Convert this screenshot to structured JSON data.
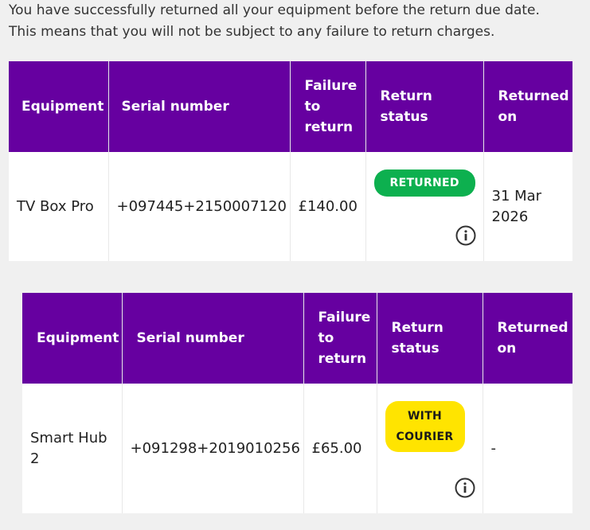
{
  "intro": {
    "line1": "You have successfully returned all your equipment before the return due date.",
    "line2": "This means that you will not be subject to any failure to return charges."
  },
  "tables": [
    {
      "headers": {
        "equipment": "Equipment",
        "serial": "Serial number",
        "failure_line1": "Failure",
        "failure_line2": "to",
        "failure_line3": "return",
        "status": "Return status",
        "returned_line1": "Returned",
        "returned_line2": "on"
      },
      "row": {
        "equipment": "TV Box Pro",
        "serial": "+097445+2150007120",
        "failure_charge": "£140.00",
        "status": "RETURNED",
        "status_color": "#0db04f",
        "returned_line1": "31 Mar",
        "returned_line2": "2026",
        "info_icon": "info-circle-icon"
      }
    },
    {
      "headers": {
        "equipment": "Equipment",
        "serial": "Serial number",
        "failure_line1": "Failure",
        "failure_line2": "to",
        "failure_line3": "return",
        "status_line1": "Return",
        "status_line2": "status",
        "returned_line1": "Returned",
        "returned_line2": "on"
      },
      "row": {
        "equipment": "Smart Hub 2",
        "serial": "+091298+2019010256",
        "failure_charge": "£65.00",
        "status_line1": "WITH",
        "status_line2": "COURIER",
        "status_color": "#ffe400",
        "returned_on": "-",
        "info_icon": "info-circle-icon"
      }
    }
  ],
  "colors": {
    "header_bg": "#6600a0",
    "page_bg": "#f0f0f0"
  }
}
